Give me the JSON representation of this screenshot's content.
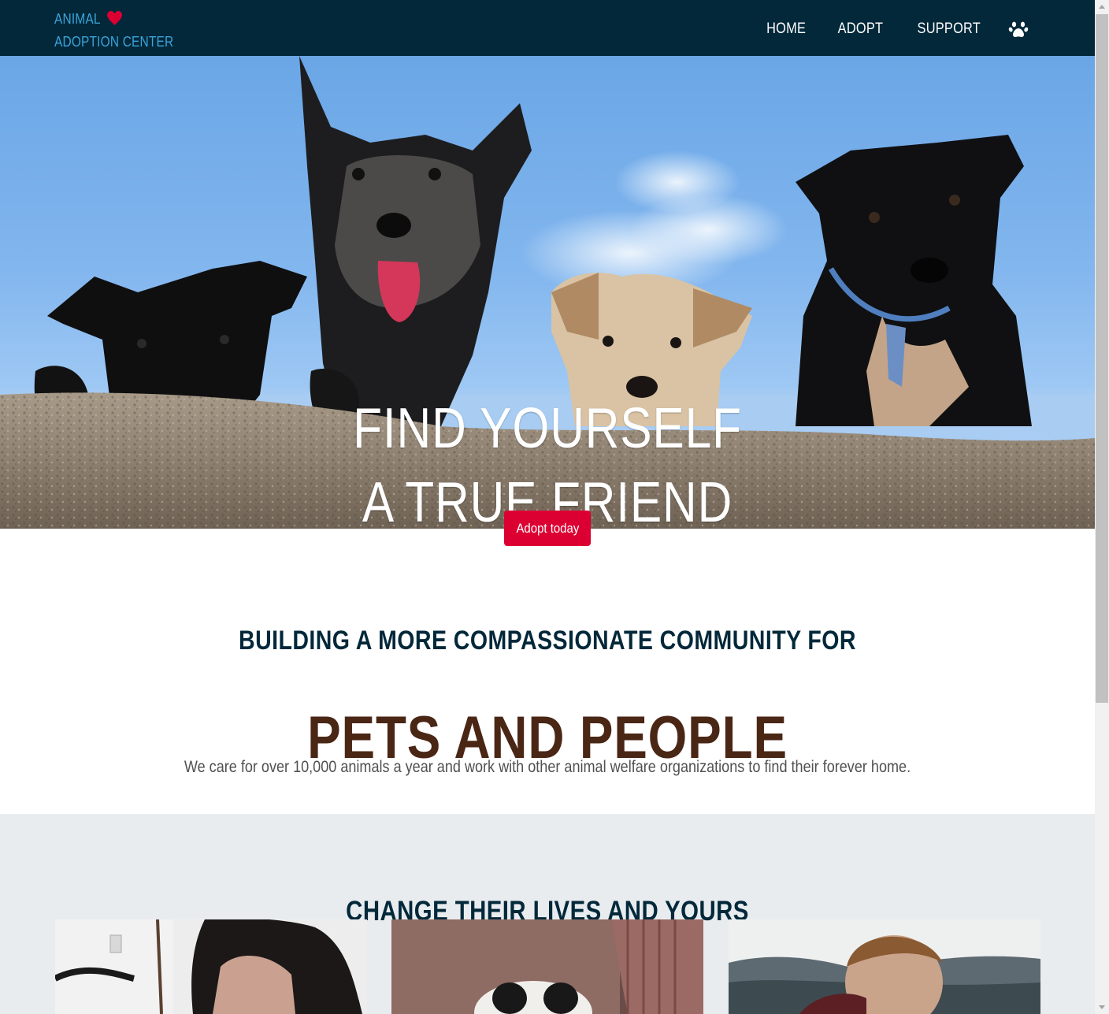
{
  "brand": {
    "line1": "ANIMAL",
    "line2": "ADOPTION CENTER",
    "color": "#3ba4da",
    "heart_color": "#dc0032"
  },
  "nav": {
    "items": [
      "HOME",
      "ADOPT",
      "SUPPORT"
    ],
    "icon": "paw-icon"
  },
  "hero": {
    "title_line1": "FIND YOURSELF",
    "title_line2": "A TRUE FRIEND",
    "cta_label": "Adopt today",
    "cta_color": "#dc0032"
  },
  "mission": {
    "subtitle": "BUILDING A MORE COMPASSIONATE COMMUNITY FOR",
    "title": "PETS AND PEOPLE",
    "text": "We care for over 10,000 animals a year and work with other animal welfare organizations to find their forever home."
  },
  "change": {
    "title": "CHANGE THEIR LIVES AND YOURS"
  },
  "colors": {
    "navbar": "#02283a",
    "title_brown": "#4a2615",
    "section_gray": "#e8ecef"
  }
}
